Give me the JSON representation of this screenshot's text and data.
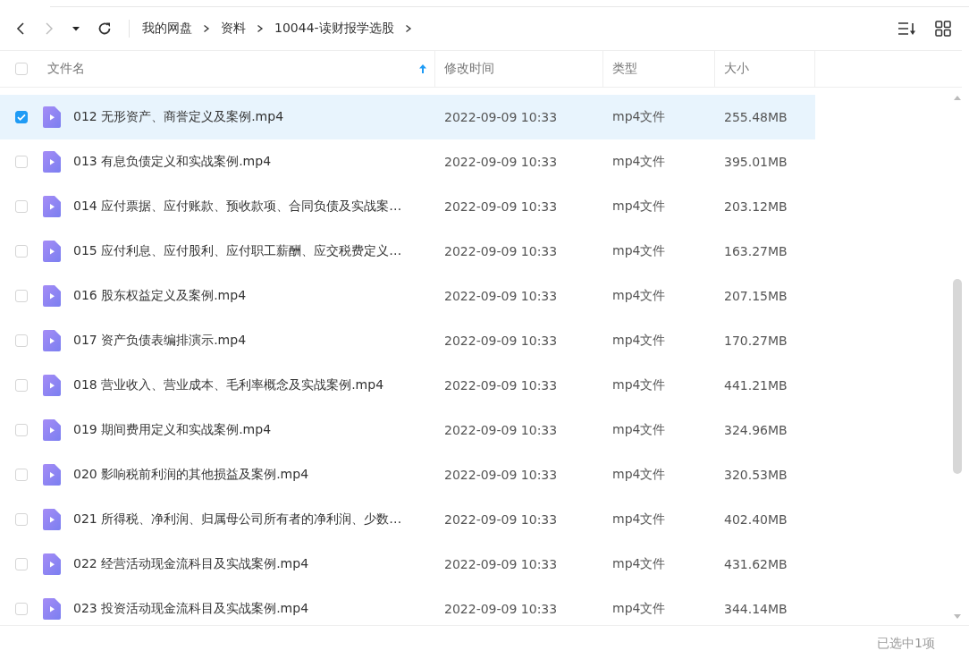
{
  "breadcrumb": [
    "我的网盘",
    "资料",
    "10044-读财报学选股"
  ],
  "columns": [
    {
      "label": "文件名",
      "sorted": true
    },
    {
      "label": "修改时间",
      "sorted": false
    },
    {
      "label": "类型",
      "sorted": false
    },
    {
      "label": "大小",
      "sorted": false
    }
  ],
  "header_checked": false,
  "rows": [
    {
      "name": "012 无形资产、商誉定义及案例.mp4",
      "modified": "2022-09-09 10:33",
      "type": "mp4文件",
      "size": "255.48MB",
      "selected": true
    },
    {
      "name": "013 有息负债定义和实战案例.mp4",
      "modified": "2022-09-09 10:33",
      "type": "mp4文件",
      "size": "395.01MB",
      "selected": false
    },
    {
      "name": "014 应付票据、应付账款、预收款项、合同负债及实战案…",
      "modified": "2022-09-09 10:33",
      "type": "mp4文件",
      "size": "203.12MB",
      "selected": false
    },
    {
      "name": "015 应付利息、应付股利、应付职工薪酬、应交税费定义…",
      "modified": "2022-09-09 10:33",
      "type": "mp4文件",
      "size": "163.27MB",
      "selected": false
    },
    {
      "name": "016 股东权益定义及案例.mp4",
      "modified": "2022-09-09 10:33",
      "type": "mp4文件",
      "size": "207.15MB",
      "selected": false
    },
    {
      "name": "017 资产负债表编排演示.mp4",
      "modified": "2022-09-09 10:33",
      "type": "mp4文件",
      "size": "170.27MB",
      "selected": false
    },
    {
      "name": "018 营业收入、营业成本、毛利率概念及实战案例.mp4",
      "modified": "2022-09-09 10:33",
      "type": "mp4文件",
      "size": "441.21MB",
      "selected": false
    },
    {
      "name": "019 期间费用定义和实战案例.mp4",
      "modified": "2022-09-09 10:33",
      "type": "mp4文件",
      "size": "324.96MB",
      "selected": false
    },
    {
      "name": "020 影响税前利润的其他损益及案例.mp4",
      "modified": "2022-09-09 10:33",
      "type": "mp4文件",
      "size": "320.53MB",
      "selected": false
    },
    {
      "name": "021 所得税、净利润、归属母公司所有者的净利润、少数…",
      "modified": "2022-09-09 10:33",
      "type": "mp4文件",
      "size": "402.40MB",
      "selected": false
    },
    {
      "name": "022 经营活动现金流科目及实战案例.mp4",
      "modified": "2022-09-09 10:33",
      "type": "mp4文件",
      "size": "431.62MB",
      "selected": false
    },
    {
      "name": "023 投资活动现金流科目及实战案例.mp4",
      "modified": "2022-09-09 10:33",
      "type": "mp4文件",
      "size": "344.14MB",
      "selected": false
    }
  ],
  "status_bar": "已选中1项"
}
